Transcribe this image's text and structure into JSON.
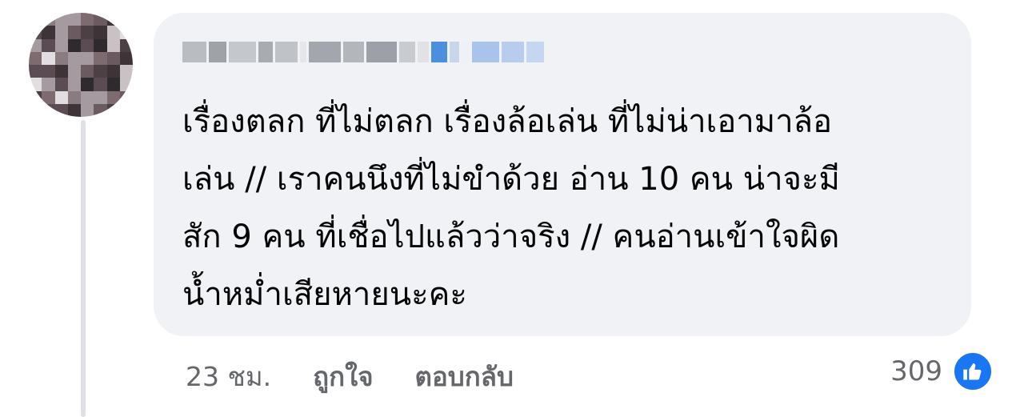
{
  "comment": {
    "text": "เรื่องตลก ที่ไม่ตลก เรื่องล้อเล่น ที่ไม่น่าเอามาล้อ\nเล่น // เราคนนึงที่ไม่ขำด้วย อ่าน 10 คน น่าจะมี\nสัก 9 คน ที่เชื่อไปแล้วว่าจริง // คนอ่านเข้าใจผิด\nน้ำหม่ำเสียหายนะคะ",
    "time": "23 ชม.",
    "like_label": "ถูกใจ",
    "reply_label": "ตอบกลับ",
    "reaction_count": "309"
  },
  "icons": {
    "reaction": "like-thumbs-up-icon",
    "avatar": "pixelated-avatar"
  },
  "colors": {
    "bubble": "#f0f2f5",
    "meta_text": "#65676b",
    "like_blue": "#1877f2",
    "thread_line": "#dfe1e5"
  }
}
